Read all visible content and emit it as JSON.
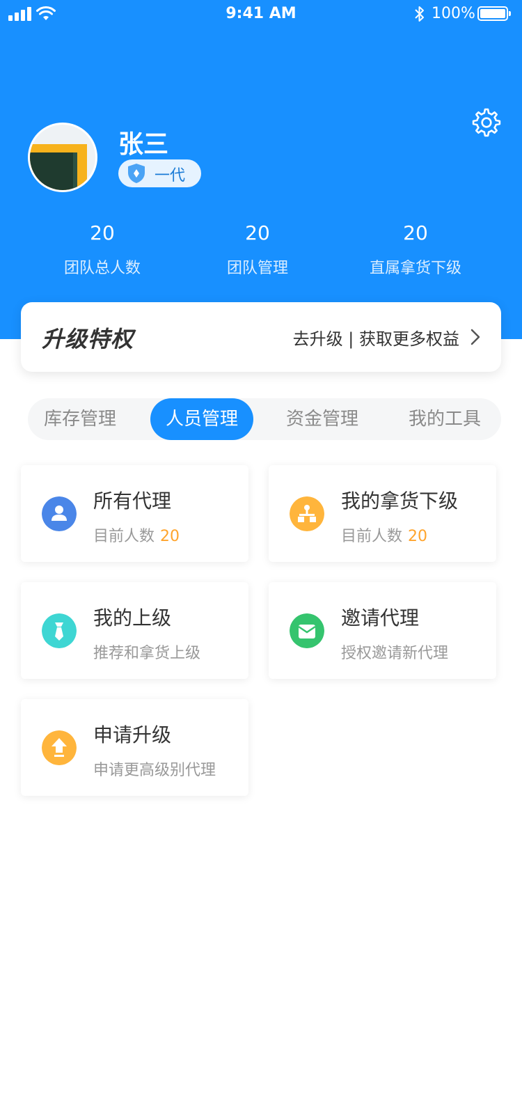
{
  "status_bar": {
    "time": "9:41 AM",
    "battery": "100%"
  },
  "profile": {
    "name": "张三",
    "level": "一代"
  },
  "stats": [
    {
      "value": "20",
      "label": "团队总人数"
    },
    {
      "value": "20",
      "label": "团队管理"
    },
    {
      "value": "20",
      "label": "直属拿货下级"
    }
  ],
  "upgrade": {
    "title": "升级特权",
    "link": "去升级 | 获取更多权益"
  },
  "tabs": [
    {
      "label": "库存管理",
      "active": false
    },
    {
      "label": "人员管理",
      "active": true
    },
    {
      "label": "资金管理",
      "active": false
    },
    {
      "label": "我的工具",
      "active": false
    }
  ],
  "cards": [
    {
      "title": "所有代理",
      "subtitle": "目前人数",
      "count": "20",
      "icon": "user-icon",
      "color": "#4a86e8"
    },
    {
      "title": "我的拿货下级",
      "subtitle": "目前人数",
      "count": "20",
      "icon": "org-chart-icon",
      "color": "#ffb53c"
    },
    {
      "title": "我的上级",
      "subtitle": "推荐和拿货上级",
      "icon": "tie-icon",
      "color": "#3ed6d3"
    },
    {
      "title": "邀请代理",
      "subtitle": "授权邀请新代理",
      "icon": "envelope-icon",
      "color": "#35c46e"
    },
    {
      "title": "申请升级",
      "subtitle": "申请更高级别代理",
      "icon": "upgrade-arrow-icon",
      "color": "#ffb53c"
    }
  ]
}
